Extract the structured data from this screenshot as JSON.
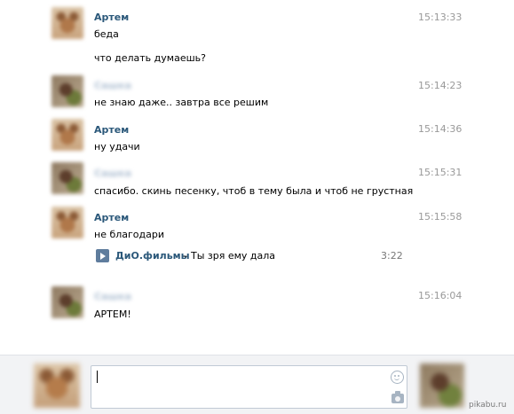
{
  "messages": [
    {
      "author": "Артем",
      "time": "15:13:33",
      "lines": [
        "беда",
        "что делать думаешь?"
      ]
    },
    {
      "author": "Сашка",
      "time": "15:14:23",
      "lines": [
        "не знаю даже.. завтра все решим"
      ]
    },
    {
      "author": "Артем",
      "time": "15:14:36",
      "lines": [
        "ну удачи"
      ]
    },
    {
      "author": "Сашка",
      "time": "15:15:31",
      "lines": [
        "спасибо. скинь песенку, чтоб в тему была и чтоб не грустная"
      ]
    },
    {
      "author": "Артем",
      "time": "15:15:58",
      "lines": [
        "не благодари"
      ],
      "audio": {
        "artist": "ДиО.фильмы",
        "title": "– Ты зря ему дала",
        "duration": "3:22",
        "icon": "play-icon"
      }
    },
    {
      "author": "Сашка",
      "time": "15:16:04",
      "lines": [
        "АРТЕМ!"
      ]
    }
  ],
  "compose": {
    "input_value": "",
    "icons": [
      "smile-icon",
      "camera-icon"
    ]
  },
  "watermark": "pikabu.ru",
  "colors": {
    "author_link": "#2b587a",
    "time": "#999999",
    "compose_bg": "#f2f3f5"
  }
}
